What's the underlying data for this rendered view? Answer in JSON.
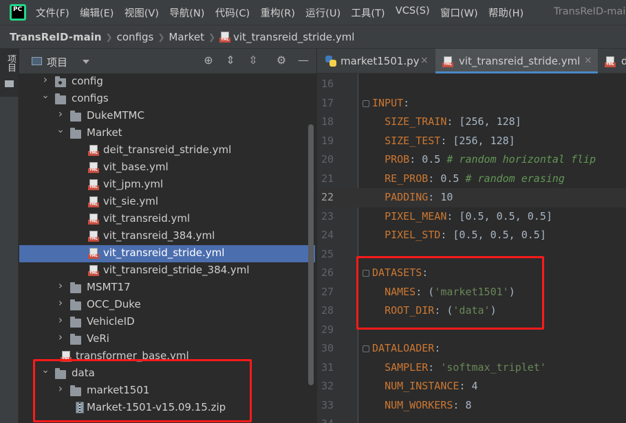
{
  "menubar": {
    "logo": "PC",
    "items": [
      "文件(F)",
      "编辑(E)",
      "视图(V)",
      "导航(N)",
      "代码(C)",
      "重构(R)",
      "运行(U)",
      "工具(T)",
      "VCS(S)",
      "窗口(W)",
      "帮助(H)"
    ],
    "window_title": "TransReID-mai"
  },
  "breadcrumb": {
    "items": [
      "TransReID-main",
      "configs",
      "Market",
      "vit_transreid_stride.yml"
    ],
    "file_icon": "yml-file-icon"
  },
  "left_strip": {
    "tab_label": "项目"
  },
  "project_panel": {
    "title": "项目",
    "tools": [
      "locate-icon",
      "expand-all-icon",
      "collapse-all-icon",
      "settings-icon",
      "minimize-icon"
    ],
    "tree": [
      {
        "name": "config",
        "type": "folder",
        "expanded": false
      },
      {
        "name": "configs",
        "type": "folder",
        "expanded": true
      },
      {
        "name": "DukeMTMC",
        "type": "folder",
        "expanded": false
      },
      {
        "name": "Market",
        "type": "folder",
        "expanded": true
      },
      {
        "name": "deit_transreid_stride.yml",
        "type": "yml"
      },
      {
        "name": "vit_base.yml",
        "type": "yml"
      },
      {
        "name": "vit_jpm.yml",
        "type": "yml"
      },
      {
        "name": "vit_sie.yml",
        "type": "yml"
      },
      {
        "name": "vit_transreid.yml",
        "type": "yml"
      },
      {
        "name": "vit_transreid_384.yml",
        "type": "yml"
      },
      {
        "name": "vit_transreid_stride.yml",
        "type": "yml",
        "selected": true
      },
      {
        "name": "vit_transreid_stride_384.yml",
        "type": "yml"
      },
      {
        "name": "MSMT17",
        "type": "folder",
        "expanded": false
      },
      {
        "name": "OCC_Duke",
        "type": "folder",
        "expanded": false
      },
      {
        "name": "VehicleID",
        "type": "folder",
        "expanded": false
      },
      {
        "name": "VeRi",
        "type": "folder",
        "expanded": false
      },
      {
        "name": "transformer_base.yml",
        "type": "yml"
      },
      {
        "name": "data",
        "type": "folder",
        "expanded": true
      },
      {
        "name": "market1501",
        "type": "folder",
        "expanded": false
      },
      {
        "name": "Market-1501-v15.09.15.zip",
        "type": "zip"
      }
    ]
  },
  "editor": {
    "tabs": [
      {
        "label": "market1501.py",
        "icon": "python-file-icon",
        "active": false
      },
      {
        "label": "vit_transreid_stride.yml",
        "icon": "yml-file-icon",
        "active": true
      },
      {
        "label": "d",
        "icon": "yml-file-icon",
        "active": false
      }
    ],
    "current_line": 22,
    "lines": [
      {
        "num": "16",
        "text": ""
      },
      {
        "num": "17",
        "text": "INPUT:"
      },
      {
        "num": "18",
        "text": "  SIZE_TRAIN: [256, 128]"
      },
      {
        "num": "19",
        "text": "  SIZE_TEST: [256, 128]"
      },
      {
        "num": "20",
        "text": "  PROB: 0.5 # random horizontal flip"
      },
      {
        "num": "21",
        "text": "  RE_PROB: 0.5 # random erasing"
      },
      {
        "num": "22",
        "text": "  PADDING: 10"
      },
      {
        "num": "23",
        "text": "  PIXEL_MEAN: [0.5, 0.5, 0.5]"
      },
      {
        "num": "24",
        "text": "  PIXEL_STD: [0.5, 0.5, 0.5]"
      },
      {
        "num": "25",
        "text": ""
      },
      {
        "num": "26",
        "text": "DATASETS:"
      },
      {
        "num": "27",
        "text": "  NAMES: ('market1501')"
      },
      {
        "num": "28",
        "text": "  ROOT_DIR: ('data')"
      },
      {
        "num": "29",
        "text": ""
      },
      {
        "num": "30",
        "text": "DATALOADER:"
      },
      {
        "num": "31",
        "text": "  SAMPLER: 'softmax_triplet'"
      },
      {
        "num": "32",
        "text": "  NUM_INSTANCE: 4"
      },
      {
        "num": "33",
        "text": "  NUM_WORKERS: 8"
      },
      {
        "num": "34",
        "text": ""
      }
    ]
  },
  "colors": {
    "highlight_box": "#ff1a1a",
    "selection": "#4b6eaf",
    "yaml_key": "#cc7832",
    "yaml_string": "#6a8759",
    "yaml_comment": "#629755"
  }
}
